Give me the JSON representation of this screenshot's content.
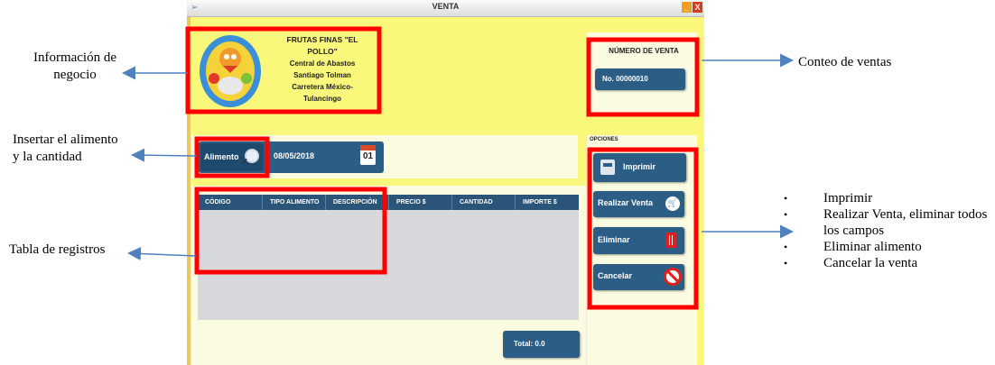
{
  "window": {
    "title": "VENTA",
    "minimize_label": "_",
    "close_label": "X"
  },
  "business": {
    "name": "FRUTAS FINAS \"EL POLLO\"",
    "line1": "Central de Abastos",
    "line2": "Santiago Tolman",
    "line3": "Carretera México- Tulancingo"
  },
  "sales": {
    "title": "NÚMERO DE VENTA",
    "number": "No.  00000010"
  },
  "food": {
    "button_label": "Alimento",
    "date": "08/05/2018",
    "calendar_day": "01"
  },
  "table": {
    "columns": [
      "CÓDIGO",
      "TIPO ALIMENTO",
      "DESCRIPCIÓN",
      "PRECIO $",
      "CANTIDAD",
      "IMPORTE $"
    ],
    "rows": []
  },
  "total": "Total: 0.0",
  "options": {
    "title": "OPCIONES",
    "print": "Imprimir",
    "sale": "Realizar Venta",
    "delete": "Eliminar",
    "cancel": "Cancelar"
  },
  "annotations": {
    "business_info": "Información de\nnegocio",
    "sales_count": "Conteo de ventas",
    "insert_food": "Insertar el alimento\ny la cantidad",
    "records_table": "Tabla de registros",
    "bullets": [
      "Imprimir",
      "Realizar Venta, eliminar todos los campos",
      "Eliminar alimento",
      "Cancelar la venta"
    ]
  },
  "colors": {
    "window_bg": "#faf87a",
    "button_blue": "#2b5d85",
    "highlight_red": "#ff0000",
    "arrow_blue": "#4f81bd"
  },
  "icons": [
    "app-icon",
    "search-icon",
    "calendar-icon",
    "printer-icon",
    "cart-icon",
    "trash-icon",
    "cancel-icon"
  ]
}
